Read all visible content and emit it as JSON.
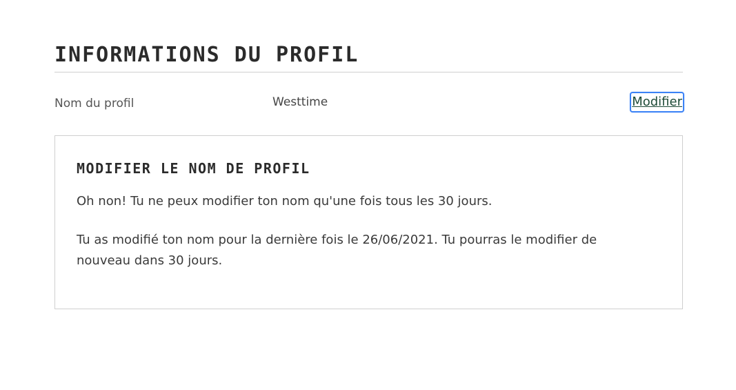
{
  "section": {
    "title": "INFORMATIONS DU PROFIL"
  },
  "profile_row": {
    "label": "Nom du profil",
    "value": "Westtime",
    "edit_link": "Modifier"
  },
  "notice": {
    "title": "MODIFIER LE NOM DE PROFIL",
    "message_1": "Oh non! Tu ne peux modifier ton nom qu'une fois tous les 30 jours.",
    "message_2": "Tu as modifié ton nom pour la dernière fois le 26/06/2021. Tu pourras le modifier de nouveau dans 30 jours."
  },
  "colors": {
    "link": "#1d4a37",
    "focus_ring": "#3b82f6",
    "divider": "#cfcfcf",
    "text": "#3a3a3a"
  }
}
